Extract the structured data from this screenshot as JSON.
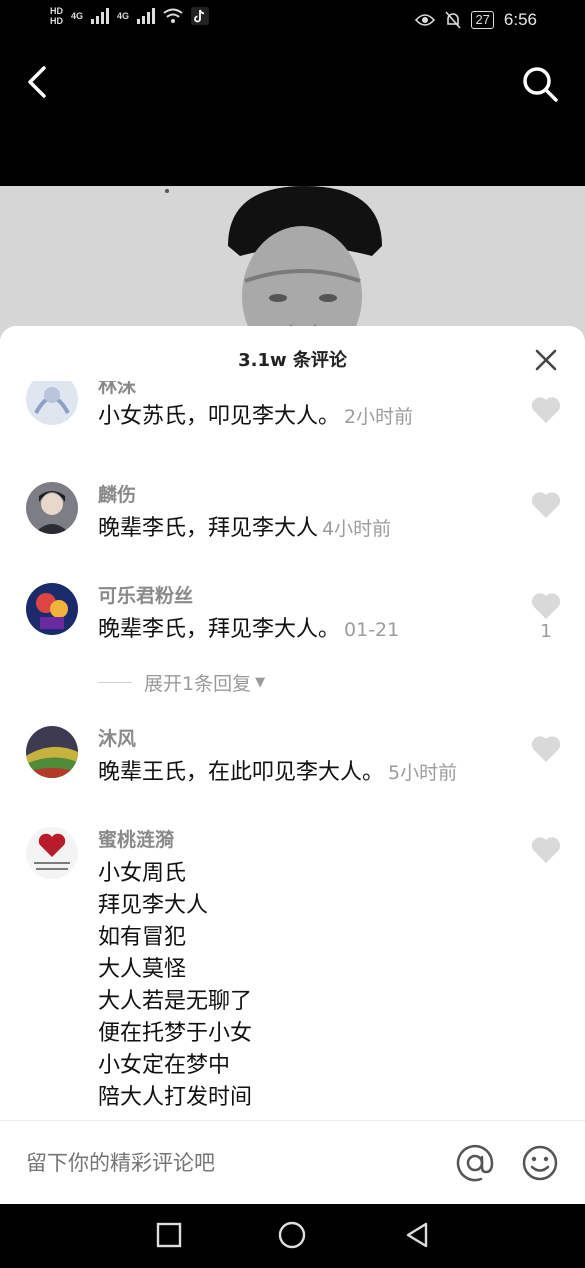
{
  "status_bar": {
    "hd_top": "HD",
    "hd_bottom": "HD",
    "sim1": "4G",
    "sim2": "4G",
    "battery": "27",
    "time": "6:56"
  },
  "sheet": {
    "title": "3.1w 条评论"
  },
  "comments": [
    {
      "name": "林沫",
      "lines": [
        "小女苏氏，叩见李大人。"
      ],
      "time": "2小时前",
      "likes": ""
    },
    {
      "name": "麟伤",
      "lines": [
        "晚辈李氏，拜见李大人"
      ],
      "time": "4小时前",
      "likes": ""
    },
    {
      "name": "可乐君粉丝",
      "lines": [
        "晚辈李氏，拜见李大人。"
      ],
      "time": "01-21",
      "likes": "1",
      "expand_label": "展开1条回复"
    },
    {
      "name": "沐风",
      "lines": [
        "晚辈王氏，在此叩见李大人。"
      ],
      "time": "5小时前",
      "likes": ""
    },
    {
      "name": "蜜桃涟漪",
      "lines": [
        "小女周氏",
        "拜见李大人",
        "如有冒犯",
        "大人莫怪",
        "大人若是无聊了",
        "便在托梦于小女",
        "小女定在梦中",
        "陪大人打发时间"
      ],
      "time": "",
      "likes": ""
    }
  ],
  "input": {
    "placeholder": "留下你的精彩评论吧"
  },
  "icons": {
    "back": "chevron-left-icon",
    "search": "search-icon",
    "close": "close-icon",
    "heart": "heart-icon",
    "at": "at-icon",
    "emoji": "smiley-icon",
    "nav_recent": "square-icon",
    "nav_home": "circle-icon",
    "nav_back": "triangle-icon"
  },
  "colors": {
    "name_gray": "#8a8a8a",
    "time_gray": "#9c9c9c",
    "heart_gray": "#d9d9d9"
  }
}
